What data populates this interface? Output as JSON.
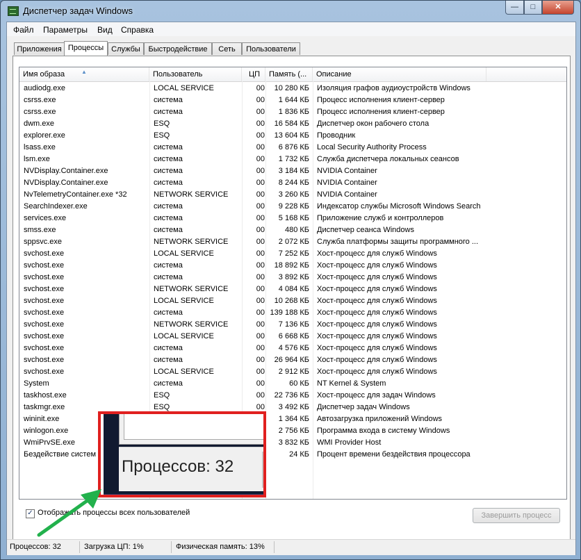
{
  "window": {
    "title": "Диспетчер задач Windows"
  },
  "menu": [
    "Файл",
    "Параметры",
    "Вид",
    "Справка"
  ],
  "tabs": [
    "Приложения",
    "Процессы",
    "Службы",
    "Быстродействие",
    "Сеть",
    "Пользователи"
  ],
  "active_tab": "Процессы",
  "columns": [
    "Имя образа",
    "Пользователь",
    "ЦП",
    "Память (...",
    "Описание"
  ],
  "processes": [
    {
      "name": "audiodg.exe",
      "user": "LOCAL SERVICE",
      "cpu": "00",
      "mem": "10 280 КБ",
      "desc": "Изоляция графов аудиоустройств Windows"
    },
    {
      "name": "csrss.exe",
      "user": "система",
      "cpu": "00",
      "mem": "1 644 КБ",
      "desc": "Процесс исполнения клиент-сервер"
    },
    {
      "name": "csrss.exe",
      "user": "система",
      "cpu": "00",
      "mem": "1 836 КБ",
      "desc": "Процесс исполнения клиент-сервер"
    },
    {
      "name": "dwm.exe",
      "user": "ESQ",
      "cpu": "00",
      "mem": "16 584 КБ",
      "desc": "Диспетчер окон рабочего стола"
    },
    {
      "name": "explorer.exe",
      "user": "ESQ",
      "cpu": "00",
      "mem": "13 604 КБ",
      "desc": "Проводник"
    },
    {
      "name": "lsass.exe",
      "user": "система",
      "cpu": "00",
      "mem": "6 876 КБ",
      "desc": "Local Security Authority Process"
    },
    {
      "name": "lsm.exe",
      "user": "система",
      "cpu": "00",
      "mem": "1 732 КБ",
      "desc": "Служба диспетчера локальных сеансов"
    },
    {
      "name": "NVDisplay.Container.exe",
      "user": "система",
      "cpu": "00",
      "mem": "3 184 КБ",
      "desc": "NVIDIA Container"
    },
    {
      "name": "NVDisplay.Container.exe",
      "user": "система",
      "cpu": "00",
      "mem": "8 244 КБ",
      "desc": "NVIDIA Container"
    },
    {
      "name": "NvTelemetryContainer.exe *32",
      "user": "NETWORK SERVICE",
      "cpu": "00",
      "mem": "3 260 КБ",
      "desc": "NVIDIA Container"
    },
    {
      "name": "SearchIndexer.exe",
      "user": "система",
      "cpu": "00",
      "mem": "9 228 КБ",
      "desc": "Индексатор службы Microsoft Windows Search"
    },
    {
      "name": "services.exe",
      "user": "система",
      "cpu": "00",
      "mem": "5 168 КБ",
      "desc": "Приложение служб и контроллеров"
    },
    {
      "name": "smss.exe",
      "user": "система",
      "cpu": "00",
      "mem": "480 КБ",
      "desc": "Диспетчер сеанса  Windows"
    },
    {
      "name": "sppsvc.exe",
      "user": "NETWORK SERVICE",
      "cpu": "00",
      "mem": "2 072 КБ",
      "desc": "Служба платформы защиты программного ..."
    },
    {
      "name": "svchost.exe",
      "user": "LOCAL SERVICE",
      "cpu": "00",
      "mem": "7 252 КБ",
      "desc": "Хост-процесс для служб Windows"
    },
    {
      "name": "svchost.exe",
      "user": "система",
      "cpu": "00",
      "mem": "18 892 КБ",
      "desc": "Хост-процесс для служб Windows"
    },
    {
      "name": "svchost.exe",
      "user": "система",
      "cpu": "00",
      "mem": "3 892 КБ",
      "desc": "Хост-процесс для служб Windows"
    },
    {
      "name": "svchost.exe",
      "user": "NETWORK SERVICE",
      "cpu": "00",
      "mem": "4 084 КБ",
      "desc": "Хост-процесс для служб Windows"
    },
    {
      "name": "svchost.exe",
      "user": "LOCAL SERVICE",
      "cpu": "00",
      "mem": "10 268 КБ",
      "desc": "Хост-процесс для служб Windows"
    },
    {
      "name": "svchost.exe",
      "user": "система",
      "cpu": "00",
      "mem": "139 188 КБ",
      "desc": "Хост-процесс для служб Windows"
    },
    {
      "name": "svchost.exe",
      "user": "NETWORK SERVICE",
      "cpu": "00",
      "mem": "7 136 КБ",
      "desc": "Хост-процесс для служб Windows"
    },
    {
      "name": "svchost.exe",
      "user": "LOCAL SERVICE",
      "cpu": "00",
      "mem": "6 668 КБ",
      "desc": "Хост-процесс для служб Windows"
    },
    {
      "name": "svchost.exe",
      "user": "система",
      "cpu": "00",
      "mem": "4 576 КБ",
      "desc": "Хост-процесс для служб Windows"
    },
    {
      "name": "svchost.exe",
      "user": "система",
      "cpu": "00",
      "mem": "26 964 КБ",
      "desc": "Хост-процесс для служб Windows"
    },
    {
      "name": "svchost.exe",
      "user": "LOCAL SERVICE",
      "cpu": "00",
      "mem": "2 912 КБ",
      "desc": "Хост-процесс для служб Windows"
    },
    {
      "name": "System",
      "user": "система",
      "cpu": "00",
      "mem": "60 КБ",
      "desc": "NT Kernel & System"
    },
    {
      "name": "taskhost.exe",
      "user": "ESQ",
      "cpu": "00",
      "mem": "22 736 КБ",
      "desc": "Хост-процесс для задач Windows"
    },
    {
      "name": "taskmgr.exe",
      "user": "ESQ",
      "cpu": "00",
      "mem": "3 492 КБ",
      "desc": "Диспетчер задач Windows"
    },
    {
      "name": "wininit.exe",
      "user": "",
      "cpu": "",
      "mem": "1 364 КБ",
      "desc": "Автозагрузка приложений Windows"
    },
    {
      "name": "winlogon.exe",
      "user": "",
      "cpu": "",
      "mem": "2 756 КБ",
      "desc": "Программа входа в систему Windows"
    },
    {
      "name": "WmiPrvSE.exe",
      "user": "",
      "cpu": "",
      "mem": "3 832 КБ",
      "desc": "WMI Provider Host"
    },
    {
      "name": "Бездействие систем",
      "user": "",
      "cpu": "",
      "mem": "24 КБ",
      "desc": "Процент времени бездействия процессора"
    }
  ],
  "show_all_label": "Отображать процессы всех пользователей",
  "show_all_checked": true,
  "end_process_label": "Завершить процесс",
  "status": {
    "processes": "Процессов: 32",
    "cpu": "Загрузка ЦП: 1%",
    "memory": "Физическая память: 13%"
  },
  "zoom_callout": {
    "text": "Процессов: 32",
    "border_color": "#e0201f",
    "arrow_color": "#22b14c"
  }
}
